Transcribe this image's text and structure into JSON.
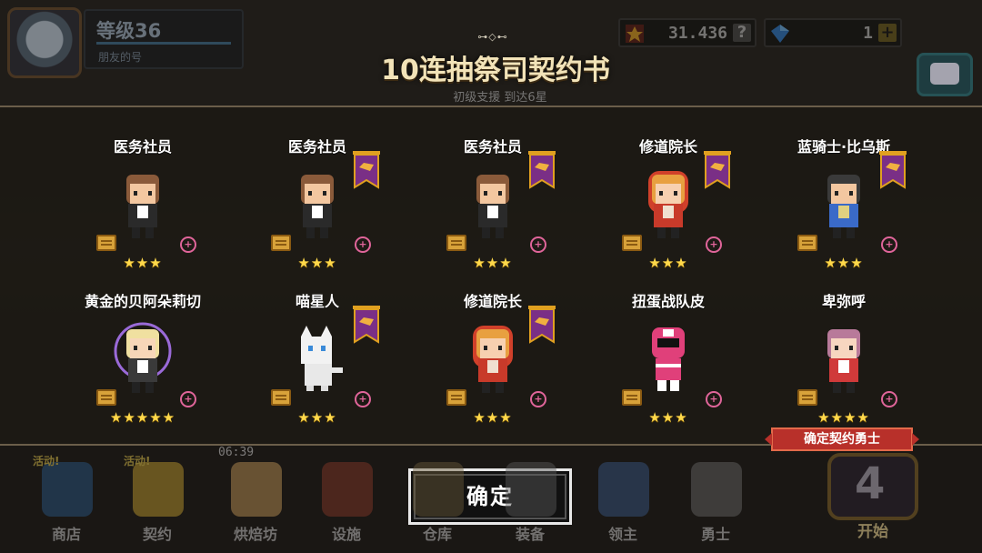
{
  "player": {
    "level": "等级36",
    "nickname": "朋友的号"
  },
  "resources": [
    {
      "icon": "trophy-icon",
      "value": "31.436",
      "suffix": "?"
    },
    {
      "icon": "gem-icon",
      "value": "1",
      "suffix": "+"
    }
  ],
  "title": {
    "ornament": "⊶◇⊷",
    "text": "10连抽祭司契约书",
    "subtitle": "初级支援  到达6星"
  },
  "results": [
    {
      "name": "医务社员",
      "stars": "★★★",
      "banner": false,
      "sprite": "medic"
    },
    {
      "name": "医务社员",
      "stars": "★★★",
      "banner": true,
      "sprite": "medic"
    },
    {
      "name": "医务社员",
      "stars": "★★★",
      "banner": true,
      "sprite": "medic"
    },
    {
      "name": "修道院长",
      "stars": "★★★",
      "banner": true,
      "sprite": "abbess"
    },
    {
      "name": "蓝骑士·比乌斯",
      "stars": "★★★",
      "banner": true,
      "sprite": "blue-knight"
    },
    {
      "name": "黄金的贝阿朵莉切",
      "stars": "★★★★★",
      "banner": false,
      "sprite": "beatrice"
    },
    {
      "name": "喵星人",
      "stars": "★★★",
      "banner": true,
      "sprite": "cat"
    },
    {
      "name": "修道院长",
      "stars": "★★★",
      "banner": true,
      "sprite": "abbess"
    },
    {
      "name": "扭蛋战队皮",
      "stars": "★★★",
      "banner": false,
      "sprite": "ranger"
    },
    {
      "name": "卑弥呼",
      "stars": "★★★★",
      "banner": false,
      "sprite": "himiko"
    }
  ],
  "confirm_tag": "确定契约勇士",
  "confirm_button": "确定",
  "nav": {
    "timer": "06:39",
    "items": [
      {
        "label": "商店",
        "badge": "活动!",
        "color": "#2a5a8a"
      },
      {
        "label": "契约",
        "badge": "活动!",
        "color": "#c8a030"
      },
      {
        "label": "烘焙坊",
        "badge": "",
        "color": "#c89a5a"
      },
      {
        "label": "设施",
        "badge": "",
        "color": "#8a3a2a"
      },
      {
        "label": "仓库",
        "badge": "",
        "color": "#6a5a3a"
      },
      {
        "label": "装备",
        "badge": "",
        "color": "#5a5a5a"
      },
      {
        "label": "领主",
        "badge": "",
        "color": "#3a5a8a"
      },
      {
        "label": "勇士",
        "badge": "",
        "color": "#6a6a6a"
      }
    ],
    "start_label": "开始",
    "start_number": "4"
  },
  "colors": {
    "accent_gold": "#ffd84a",
    "banner": "#7a2f86",
    "confirm_tag": "#b8302a"
  }
}
